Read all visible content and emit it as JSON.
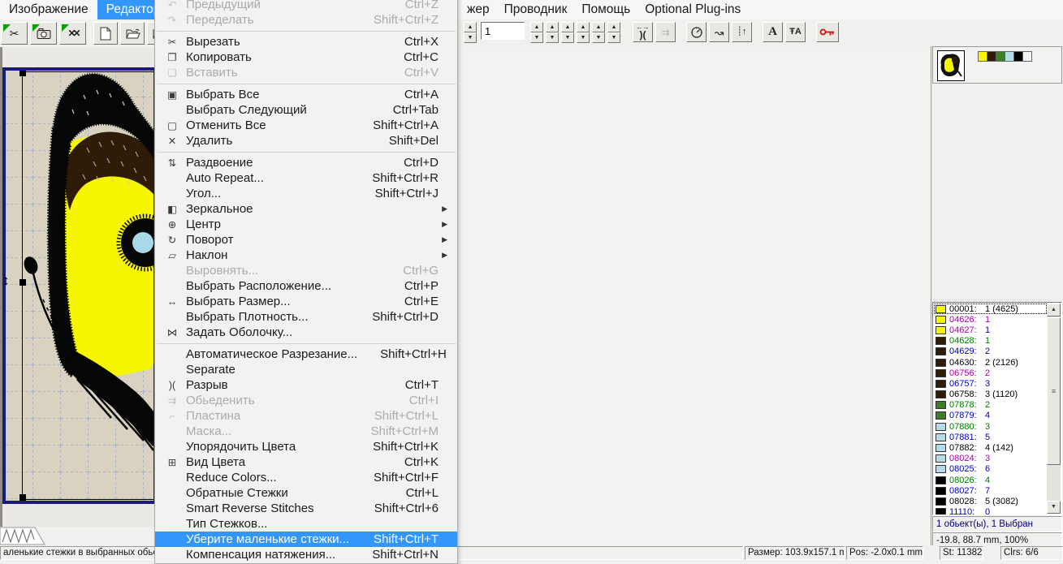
{
  "menubar": {
    "left_items": [
      {
        "label": "Изображение"
      },
      {
        "label": "Редактор",
        "state": "active"
      }
    ],
    "right_items": [
      {
        "label": "жер"
      },
      {
        "label": "Проводник"
      },
      {
        "label": "Помощь"
      },
      {
        "label": "Optional Plug-ins"
      }
    ],
    "active_bg": "#3296fa"
  },
  "toolbar_left": {
    "icons": [
      "green-flag-stitch-scissors",
      "green-flag-camera",
      "green-flag-remove-stitches",
      "new-document",
      "open-folder",
      "add-to-folder"
    ]
  },
  "toolbar_right": {
    "order_value": "1",
    "spinner_pairs": [
      {
        "up": "▲",
        "down": "▼"
      },
      {
        "up": "▲",
        "down": "▼"
      },
      {
        "up": "▲",
        "down": "▼"
      },
      {
        "up": "▲",
        "down": "▼"
      },
      {
        "up": "▲",
        "down": "▼"
      },
      {
        "up": "▲",
        "down": "▼"
      }
    ],
    "break_icon_top": "←→",
    "break_icon": ")(",
    "merge_icon": "⇉",
    "wave_arrow_icon": "↝",
    "stitch_up_icon": "┊↑",
    "letter_a_icon": "A",
    "text_edit_icon": "ŦA",
    "icons": [
      "break-stitches",
      "merge-stitches",
      "stitch-gauge",
      "stitch-direction",
      "stitch-density",
      "letter-a-font",
      "text-edit",
      "red-key-lock"
    ]
  },
  "edit_menu": {
    "highlight_color": "#3296fa",
    "items": [
      {
        "label": "Предыдущий",
        "shortcut": "Ctrl+Z",
        "state": "disabled",
        "icon": "undo"
      },
      {
        "label": "Переделать",
        "shortcut": "Shift+Ctrl+Z",
        "state": "disabled",
        "icon": "redo",
        "sep_after": true
      },
      {
        "label": "Вырезать",
        "shortcut": "Ctrl+X",
        "icon": "scissors"
      },
      {
        "label": "Копировать",
        "shortcut": "Ctrl+C",
        "icon": "copy"
      },
      {
        "label": "Вставить",
        "shortcut": "Ctrl+V",
        "state": "disabled",
        "icon": "paste",
        "sep_after": true
      },
      {
        "label": "Выбрать Все",
        "shortcut": "Ctrl+A",
        "icon": "select-all"
      },
      {
        "label": "Выбрать Следующий",
        "shortcut": "Ctrl+Tab"
      },
      {
        "label": "Отменить  Все",
        "shortcut": "Shift+Ctrl+A",
        "icon": "deselect"
      },
      {
        "label": "Удалить",
        "shortcut": "Shift+Del",
        "icon": "delete",
        "sep_after": true
      },
      {
        "label": "Раздвоение",
        "shortcut": "Ctrl+D",
        "icon": "split"
      },
      {
        "label": "Auto Repeat...",
        "shortcut": "Shift+Ctrl+R"
      },
      {
        "label": "Угол...",
        "shortcut": "Shift+Ctrl+J"
      },
      {
        "label": "Зеркальное",
        "icon": "mirror",
        "arrow": "submenu"
      },
      {
        "label": "Центр",
        "icon": "center",
        "arrow": "submenu"
      },
      {
        "label": "Поворот",
        "icon": "rotate",
        "arrow": "submenu"
      },
      {
        "label": "Наклон",
        "icon": "skew",
        "arrow": "submenu"
      },
      {
        "label": "Выровнять...",
        "shortcut": "Ctrl+G",
        "state": "disabled"
      },
      {
        "label": "Выбрать Расположение...",
        "shortcut": "Ctrl+P"
      },
      {
        "label": "Выбрать Размер...",
        "shortcut": "Ctrl+E",
        "icon": "resize"
      },
      {
        "label": "Выбрать Плотность...",
        "shortcut": "Shift+Ctrl+D"
      },
      {
        "label": "Задать  Оболочку...",
        "icon": "envelope",
        "sep_after": true
      },
      {
        "label": "Автоматическое Разрезание...",
        "shortcut": "Shift+Ctrl+H"
      },
      {
        "label": "Separate"
      },
      {
        "label": "Разрыв",
        "shortcut": "Ctrl+T",
        "icon": "break"
      },
      {
        "label": "Обьеденить",
        "shortcut": "Ctrl+I",
        "state": "disabled",
        "icon": "merge"
      },
      {
        "label": "Пластина",
        "shortcut": "Shift+Ctrl+L",
        "state": "disabled",
        "icon": "plate"
      },
      {
        "label": "Маска...",
        "shortcut": "Shift+Ctrl+M",
        "state": "disabled"
      },
      {
        "label": "Упорядочить Цвета",
        "shortcut": "Shift+Ctrl+K"
      },
      {
        "label": "Вид Цвета",
        "shortcut": "Ctrl+K",
        "icon": "color-grid"
      },
      {
        "label": "Reduce Colors...",
        "shortcut": "Shift+Ctrl+F"
      },
      {
        "label": "Обратные Стежки",
        "shortcut": "Ctrl+L"
      },
      {
        "label": "Smart Reverse Stitches",
        "shortcut": "Shift+Ctrl+6"
      },
      {
        "label": "Тип Стежков..."
      },
      {
        "label": "Уберите маленькие стежки...",
        "shortcut": "Shift+Ctrl+T",
        "state": "highlighted"
      },
      {
        "label": "Компенсация натяжения...",
        "shortcut": "Shift+Ctrl+N"
      }
    ]
  },
  "canvas": {
    "bg": "#d9d2c0",
    "border": "#1a1a78",
    "grid": "#a9b2cf",
    "design_colors": {
      "yellow": "#f6f600",
      "brown": "#2e1c08",
      "blue_spot": "#a9d9e9",
      "black": "#060606"
    }
  },
  "right_panel": {
    "palette_swatches": [
      "#f6f600",
      "#2e1c08",
      "#3f7d28",
      "#b4dce8",
      "#000000",
      "#f4f4f2"
    ],
    "color_list": [
      {
        "swatch": "#f6f600",
        "label": "00001:",
        "value": "1 (4625)",
        "label_color": "#000000",
        "value_color": "#000000",
        "state": "selected"
      },
      {
        "swatch": "#f6f600",
        "label": "04626:",
        "value": "1",
        "label_color": "#aa00aa",
        "value_color": "#aa00aa"
      },
      {
        "swatch": "#f6f600",
        "label": "04627:",
        "value": "1",
        "label_color": "#aa00aa",
        "value_color": "#0000bb"
      },
      {
        "swatch": "#2e1c08",
        "label": "04628:",
        "value": "1",
        "label_color": "#007700",
        "value_color": "#007700"
      },
      {
        "swatch": "#2e1c08",
        "label": "04629:",
        "value": "2",
        "label_color": "#0000bb",
        "value_color": "#0000bb"
      },
      {
        "swatch": "#2e1c08",
        "label": "04630:",
        "value": "2 (2126)",
        "label_color": "#000000",
        "value_color": "#000000"
      },
      {
        "swatch": "#2e1c08",
        "label": "06756:",
        "value": "2",
        "label_color": "#aa00aa",
        "value_color": "#aa00aa"
      },
      {
        "swatch": "#2e1c08",
        "label": "06757:",
        "value": "3",
        "label_color": "#0000bb",
        "value_color": "#0000bb"
      },
      {
        "swatch": "#2e1c08",
        "label": "06758:",
        "value": "3 (1120)",
        "label_color": "#000000",
        "value_color": "#000000"
      },
      {
        "swatch": "#3f7d28",
        "label": "07878:",
        "value": "2",
        "label_color": "#007700",
        "value_color": "#007700"
      },
      {
        "swatch": "#3f7d28",
        "label": "07879:",
        "value": "4",
        "label_color": "#0000bb",
        "value_color": "#0000bb"
      },
      {
        "swatch": "#b4dce8",
        "label": "07880:",
        "value": "3",
        "label_color": "#007700",
        "value_color": "#007700"
      },
      {
        "swatch": "#b4dce8",
        "label": "07881:",
        "value": "5",
        "label_color": "#0000bb",
        "value_color": "#0000bb"
      },
      {
        "swatch": "#b4dce8",
        "label": "07882:",
        "value": "4 (142)",
        "label_color": "#000000",
        "value_color": "#000000"
      },
      {
        "swatch": "#b4dce8",
        "label": "08024:",
        "value": "3",
        "label_color": "#aa00aa",
        "value_color": "#aa00aa"
      },
      {
        "swatch": "#b4dce8",
        "label": "08025:",
        "value": "6",
        "label_color": "#0000bb",
        "value_color": "#0000bb"
      },
      {
        "swatch": "#000000",
        "label": "08026:",
        "value": "4",
        "label_color": "#007700",
        "value_color": "#007700"
      },
      {
        "swatch": "#000000",
        "label": "08027:",
        "value": "7",
        "label_color": "#0000bb",
        "value_color": "#0000bb"
      },
      {
        "swatch": "#000000",
        "label": "08028:",
        "value": "5 (3082)",
        "label_color": "#000000",
        "value_color": "#000000"
      },
      {
        "swatch": "#000000",
        "label": "11110:",
        "value": "0",
        "label_color": "#0000bb",
        "value_color": "#0000bb"
      }
    ],
    "objects_info": "1 обьект(ы), 1 Выбран",
    "position_info": "-19.8, 88.7 mm, 100%"
  },
  "statusbar": {
    "hint": "аленькие стежки в выбранных обьек",
    "size": "Размер: 103.9x157.1 m",
    "position": "Pos: -2.0x0.1 mm",
    "stitches": "St: 11382",
    "colors": "Clrs: 6/6"
  }
}
